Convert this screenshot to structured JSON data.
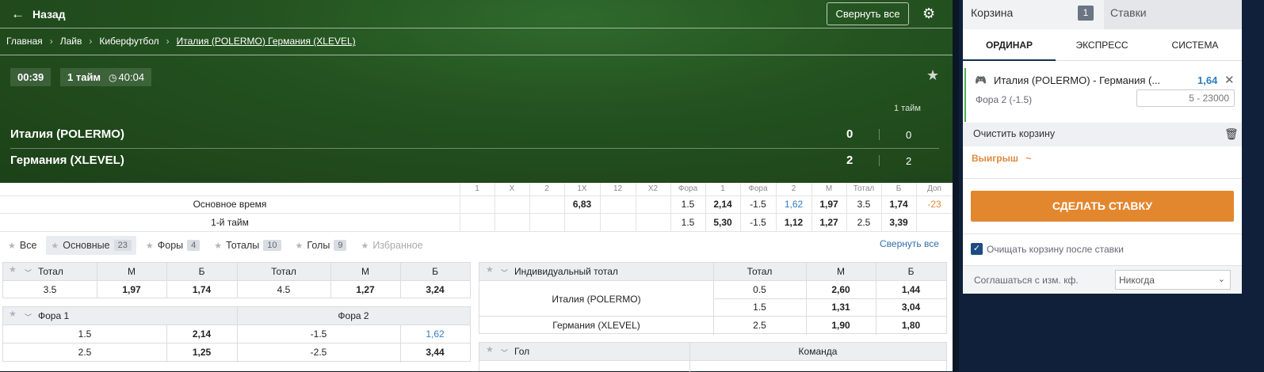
{
  "header": {
    "back_label": "Назад",
    "collapse_all": "Свернуть все",
    "breadcrumbs": [
      "Главная",
      "Лайв",
      "Киберфутбол",
      "Италия (POLERMO) Германия (XLEVEL)"
    ]
  },
  "match": {
    "time": "00:39",
    "period": "1 тайм",
    "clock": "40:04",
    "period_col": "1 тайм",
    "team1": "Италия (POLERMO)",
    "team2": "Германия (XLEVEL)",
    "score1": "0",
    "score2": "2",
    "period_score1": "0",
    "period_score2": "2"
  },
  "odds": {
    "headers": [
      "1",
      "X",
      "2",
      "1X",
      "12",
      "X2",
      "Фора",
      "1",
      "Фора",
      "2",
      "М",
      "Тотал",
      "Б",
      "Доп"
    ],
    "rows": [
      {
        "label": "Основное время",
        "cells": [
          "",
          "",
          "",
          "6,83",
          "",
          "",
          "1.5",
          "2,14",
          "-1.5",
          "1,62",
          "1,97",
          "3.5",
          "1,74",
          "-23"
        ]
      },
      {
        "label": "1-й тайм",
        "cells": [
          "",
          "",
          "",
          "",
          "",
          "",
          "1.5",
          "5,30",
          "-1.5",
          "1,12",
          "1,27",
          "2.5",
          "3,39",
          ""
        ]
      }
    ]
  },
  "filters": [
    {
      "label": "Все",
      "count": ""
    },
    {
      "label": "Основные",
      "count": "23"
    },
    {
      "label": "Форы",
      "count": "4"
    },
    {
      "label": "Тоталы",
      "count": "10"
    },
    {
      "label": "Голы",
      "count": "9"
    },
    {
      "label": "Избранное",
      "count": ""
    }
  ],
  "collapse_link": "Свернуть все",
  "total_table": {
    "headers": [
      "Тотал",
      "М",
      "Б",
      "Тотал",
      "М",
      "Б"
    ],
    "row": [
      "3.5",
      "1,97",
      "1,74",
      "4.5",
      "1,27",
      "3,24"
    ]
  },
  "fora_table": {
    "h1": "Фора 1",
    "h2": "Фора 2",
    "rows": [
      [
        "1.5",
        "2,14",
        "-1.5",
        "1,62"
      ],
      [
        "2.5",
        "1,25",
        "-2.5",
        "3,44"
      ]
    ]
  },
  "ind_total": {
    "title": "Индивидуальный тотал",
    "headers": [
      "Тотал",
      "М",
      "Б"
    ],
    "team1": "Италия (POLERMO)",
    "team2": "Германия (XLEVEL)",
    "rows": [
      [
        "0.5",
        "2,60",
        "1,44"
      ],
      [
        "1.5",
        "1,31",
        "3,04"
      ],
      [
        "2.5",
        "1,90",
        "1,80"
      ]
    ]
  },
  "goal_table": {
    "title": "Гол",
    "team_col": "Команда"
  },
  "betslip": {
    "tab_cart": "Корзина",
    "cart_count": "1",
    "tab_bets": "Ставки",
    "types": [
      "ОРДИНАР",
      "ЭКСПРЕСС",
      "СИСТЕМА"
    ],
    "event": "Италия (POLERMO) - Германия (...",
    "odd": "1,64",
    "market": "Фора 2 (-1.5)",
    "stake_placeholder": "5 - 23000",
    "clear": "Очистить корзину",
    "win": "Выигрыш",
    "win_value": "~",
    "place_bet": "СДЕЛАТЬ СТАВКУ",
    "clear_after": "Очищать корзину после ставки",
    "agree_label": "Соглашаться с изм. кф.",
    "agree_value": "Никогда"
  },
  "colors": {
    "hero": "#245220",
    "accent": "#e3872f",
    "link": "#2f7cc0",
    "panel": "#10203a"
  }
}
